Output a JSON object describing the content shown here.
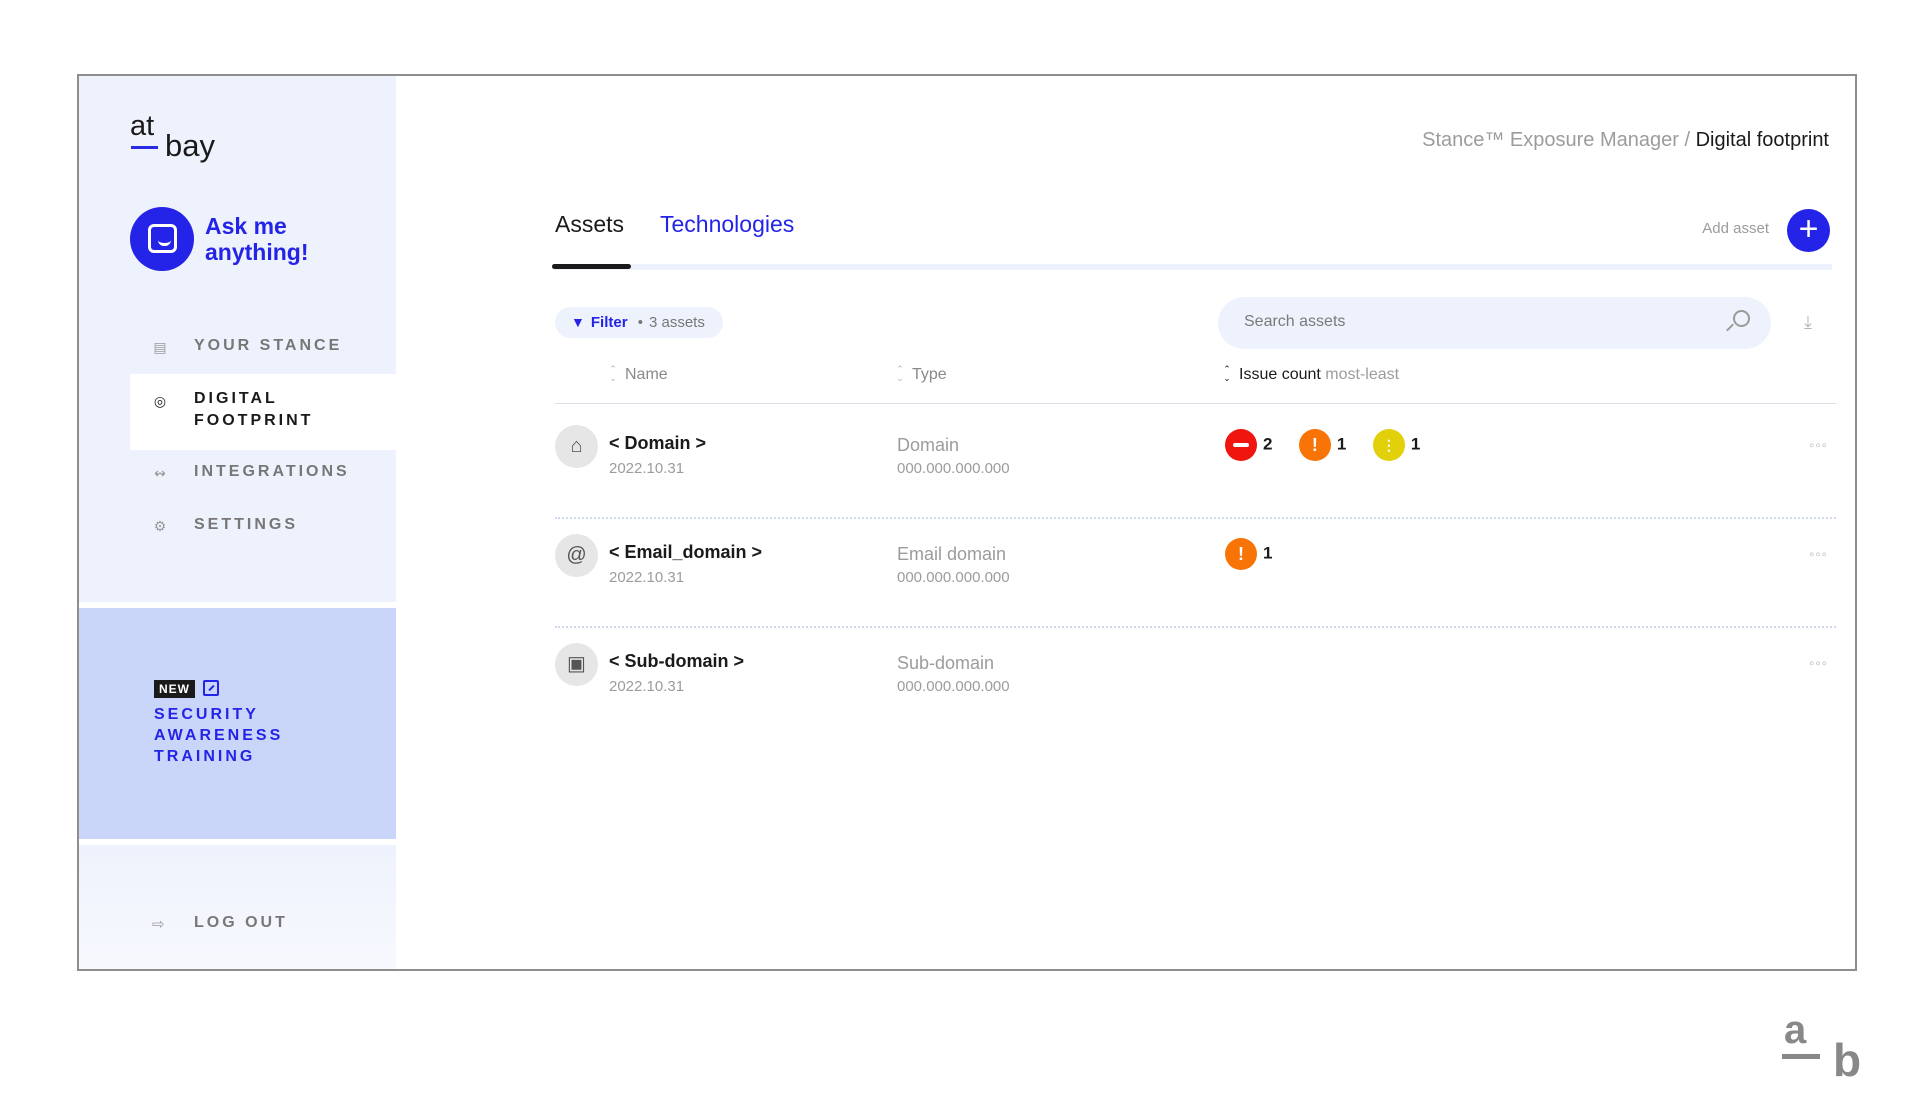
{
  "sidebar": {
    "logo": {
      "top": "at",
      "bottom": "bay"
    },
    "ask": "Ask me anything!",
    "nav": [
      {
        "label": "YOUR STANCE",
        "icon": "chart-icon"
      },
      {
        "label": "DIGITAL FOOTPRINT",
        "icon": "globe-icon",
        "active": true
      },
      {
        "label": "INTEGRATIONS",
        "icon": "integrations-icon"
      },
      {
        "label": "SETTINGS",
        "icon": "gear-icon"
      }
    ],
    "promo": {
      "badge": "NEW",
      "title": "SECURITY\nAWARENESS\nTRAINING"
    },
    "logout": "LOG OUT"
  },
  "header": {
    "breadcrumb_parent": "Stance™ Exposure Manager",
    "breadcrumb_sep": " / ",
    "breadcrumb_current": "Digital footprint"
  },
  "tabs": [
    {
      "label": "Assets",
      "active": true
    },
    {
      "label": "Technologies",
      "active": false
    }
  ],
  "add_asset_label": "Add asset",
  "add_asset_symbol": "+",
  "filter": {
    "label": "Filter",
    "count": "3 assets",
    "sep": "•"
  },
  "search": {
    "placeholder": "Search assets"
  },
  "columns": {
    "name": "Name",
    "type": "Type",
    "issue": "Issue count",
    "issue_sort": "most-least"
  },
  "rows": [
    {
      "name": "< Domain >",
      "date": "2022.10.31",
      "type": "Domain",
      "ip": "000.000.000.000",
      "issues": [
        {
          "severity": "critical",
          "count": "2"
        },
        {
          "severity": "high",
          "count": "1"
        },
        {
          "severity": "medium",
          "count": "1"
        }
      ]
    },
    {
      "name": "< Email_domain >",
      "date": "2022.10.31",
      "type": "Email domain",
      "ip": "000.000.000.000",
      "issues": [
        {
          "severity": "high",
          "count": "1"
        }
      ]
    },
    {
      "name": "< Sub-domain >",
      "date": "2022.10.31",
      "type": "Sub-domain",
      "ip": "000.000.000.000",
      "issues": []
    }
  ],
  "colors": {
    "accent": "#2424e8",
    "critical": "#f0160f",
    "high": "#f97407",
    "medium": "#e1d00a"
  },
  "brand_mark": {
    "a": "a",
    "b": "b"
  }
}
